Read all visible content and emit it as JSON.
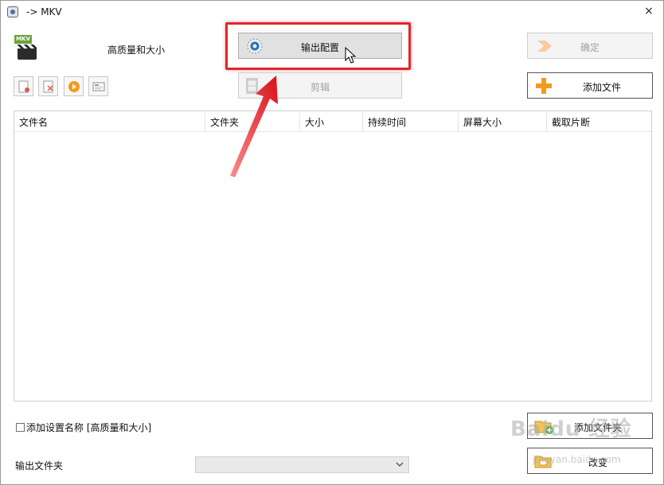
{
  "window": {
    "title": "-> MKV",
    "close_label": "×"
  },
  "profile": {
    "format_tag": "MKV",
    "name": "高质量和大小"
  },
  "buttons": {
    "output_config": "输出配置",
    "edit": "剪辑",
    "ok": "确定",
    "add_file": "添加文件",
    "add_folder": "添加文件夹",
    "change": "改变"
  },
  "table": {
    "columns": [
      "文件名",
      "文件夹",
      "大小",
      "持续时间",
      "屏幕大小",
      "截取片断"
    ],
    "rows": []
  },
  "options": {
    "add_setting_name_label": "添加设置名称 [高质量和大小]",
    "add_setting_name_checked": false
  },
  "output_folder": {
    "label": "输出文件夹",
    "value": ""
  },
  "watermark": {
    "text": "Baidu 经验",
    "sub": "jingyan.baidu.com"
  },
  "colors": {
    "highlight": "#e0262b",
    "accent_orange": "#f39a1e"
  },
  "icons": {
    "output_config": "gear-icon",
    "edit": "film-edit-icon",
    "ok": "arrow-right-icon",
    "add_file": "plus-icon",
    "add_folder": "folder-add-icon",
    "change": "folder-change-icon",
    "toolbar": [
      "remove-file-icon",
      "clear-list-icon",
      "play-icon",
      "info-icon"
    ]
  }
}
